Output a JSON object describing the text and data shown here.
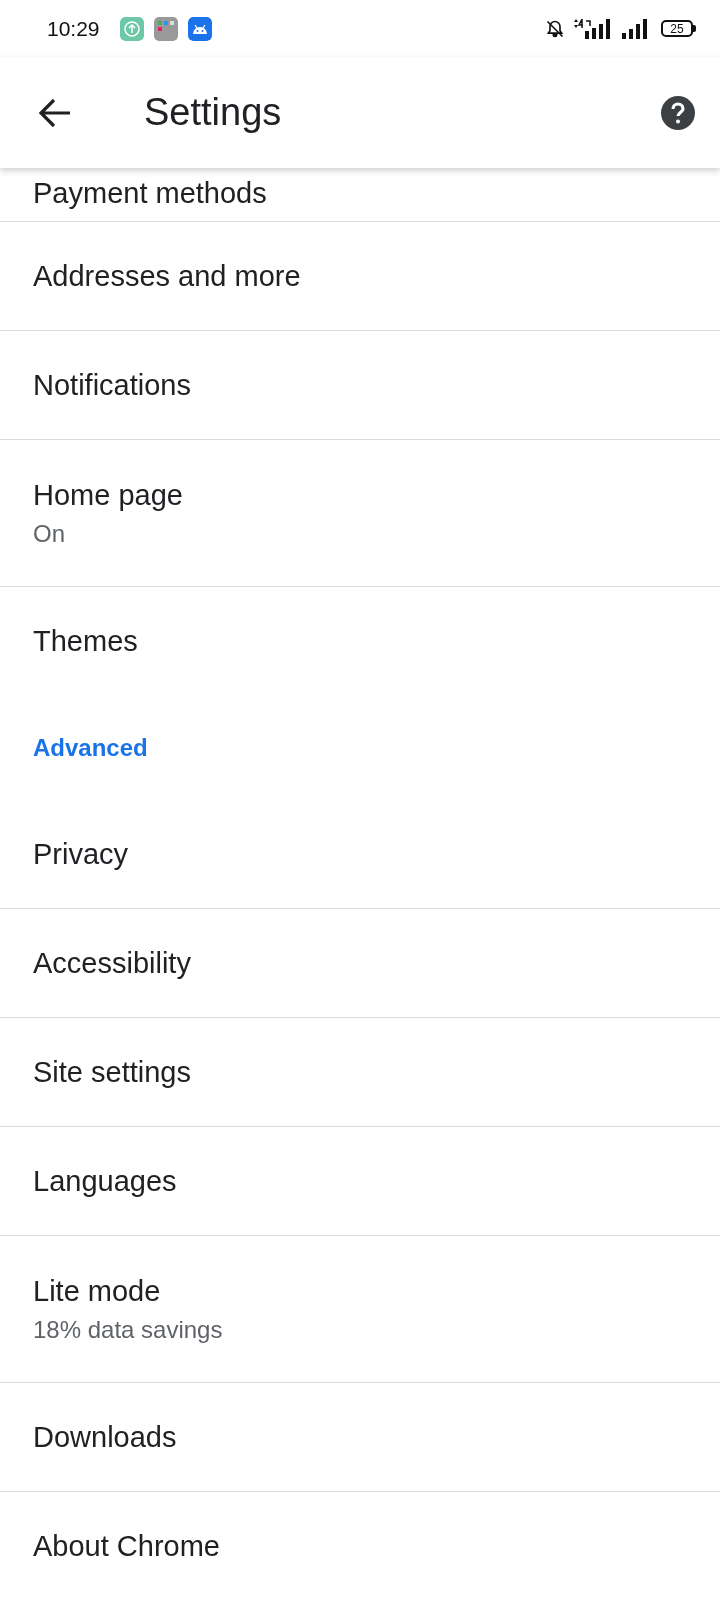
{
  "status_bar": {
    "time": "10:29",
    "battery": "25"
  },
  "app_bar": {
    "title": "Settings"
  },
  "items": [
    {
      "kind": "cut",
      "title": "Payment methods"
    },
    {
      "kind": "row",
      "title": "Addresses and more"
    },
    {
      "kind": "row",
      "title": "Notifications"
    },
    {
      "kind": "row",
      "title": "Home page",
      "summary": "On"
    },
    {
      "kind": "last",
      "title": "Themes"
    },
    {
      "kind": "section",
      "title": "Advanced"
    },
    {
      "kind": "row",
      "title": "Privacy"
    },
    {
      "kind": "row",
      "title": "Accessibility"
    },
    {
      "kind": "row",
      "title": "Site settings"
    },
    {
      "kind": "row",
      "title": "Languages"
    },
    {
      "kind": "row",
      "title": "Lite mode",
      "summary": "18% data savings"
    },
    {
      "kind": "row",
      "title": "Downloads"
    },
    {
      "kind": "row",
      "title": "About Chrome"
    }
  ]
}
